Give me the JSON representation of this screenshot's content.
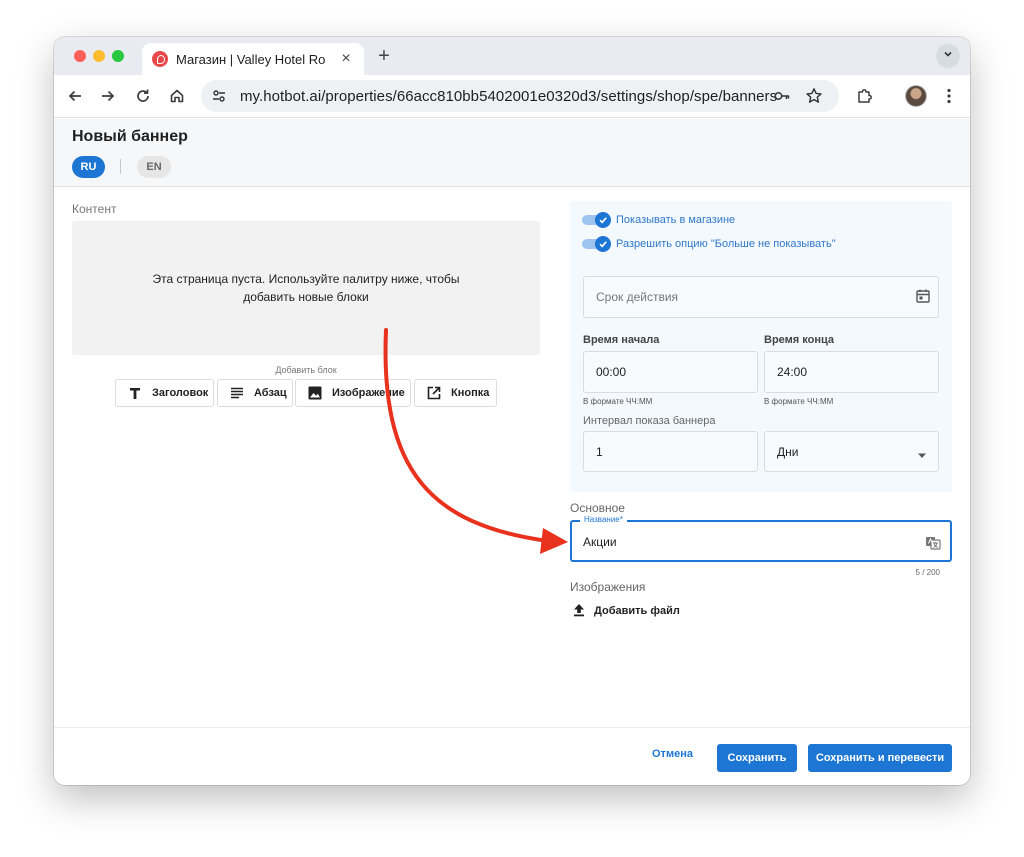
{
  "browser": {
    "tab_title": "Магазин | Valley Hotel Rosa K",
    "tab_close": "×",
    "new_tab": "+",
    "url": "my.hotbot.ai/properties/66acc810bb5402001e0320d3/settings/shop/spe/banners"
  },
  "header": {
    "title": "Новый баннер",
    "lang_ru": "RU",
    "lang_en": "EN"
  },
  "content": {
    "label": "Контент",
    "empty_line1": "Эта страница пуста. Используйте палитру ниже, чтобы",
    "empty_line2": "добавить новые блоки",
    "add_block_label": "Добавить блок",
    "blocks": {
      "heading": "Заголовок",
      "paragraph": "Абзац",
      "image": "Изображение",
      "button": "Кнопка"
    }
  },
  "settings": {
    "show_in_shop": "Показывать в магазине",
    "allow_dont_show": "Разрешить опцию \"Больше не показывать\"",
    "validity_placeholder": "Срок действия",
    "start_label": "Время начала",
    "start_value": "00:00",
    "start_hint": "В формате ЧЧ:ММ",
    "end_label": "Время конца",
    "end_value": "24:00",
    "end_hint": "В формате ЧЧ:ММ",
    "interval_label": "Интервал показа баннера",
    "interval_value": "1",
    "interval_unit": "Дни"
  },
  "main": {
    "label": "Основное",
    "name_legend": "Название*",
    "name_value": "Акции",
    "counter": "5 / 200",
    "images_label": "Изображения",
    "add_file": "Добавить файл"
  },
  "footer": {
    "cancel": "Отмена",
    "save": "Сохранить",
    "save_translate": "Сохранить и перевести"
  },
  "colors": {
    "accent": "#1e76d4",
    "annotation_arrow": "#e8321e"
  }
}
